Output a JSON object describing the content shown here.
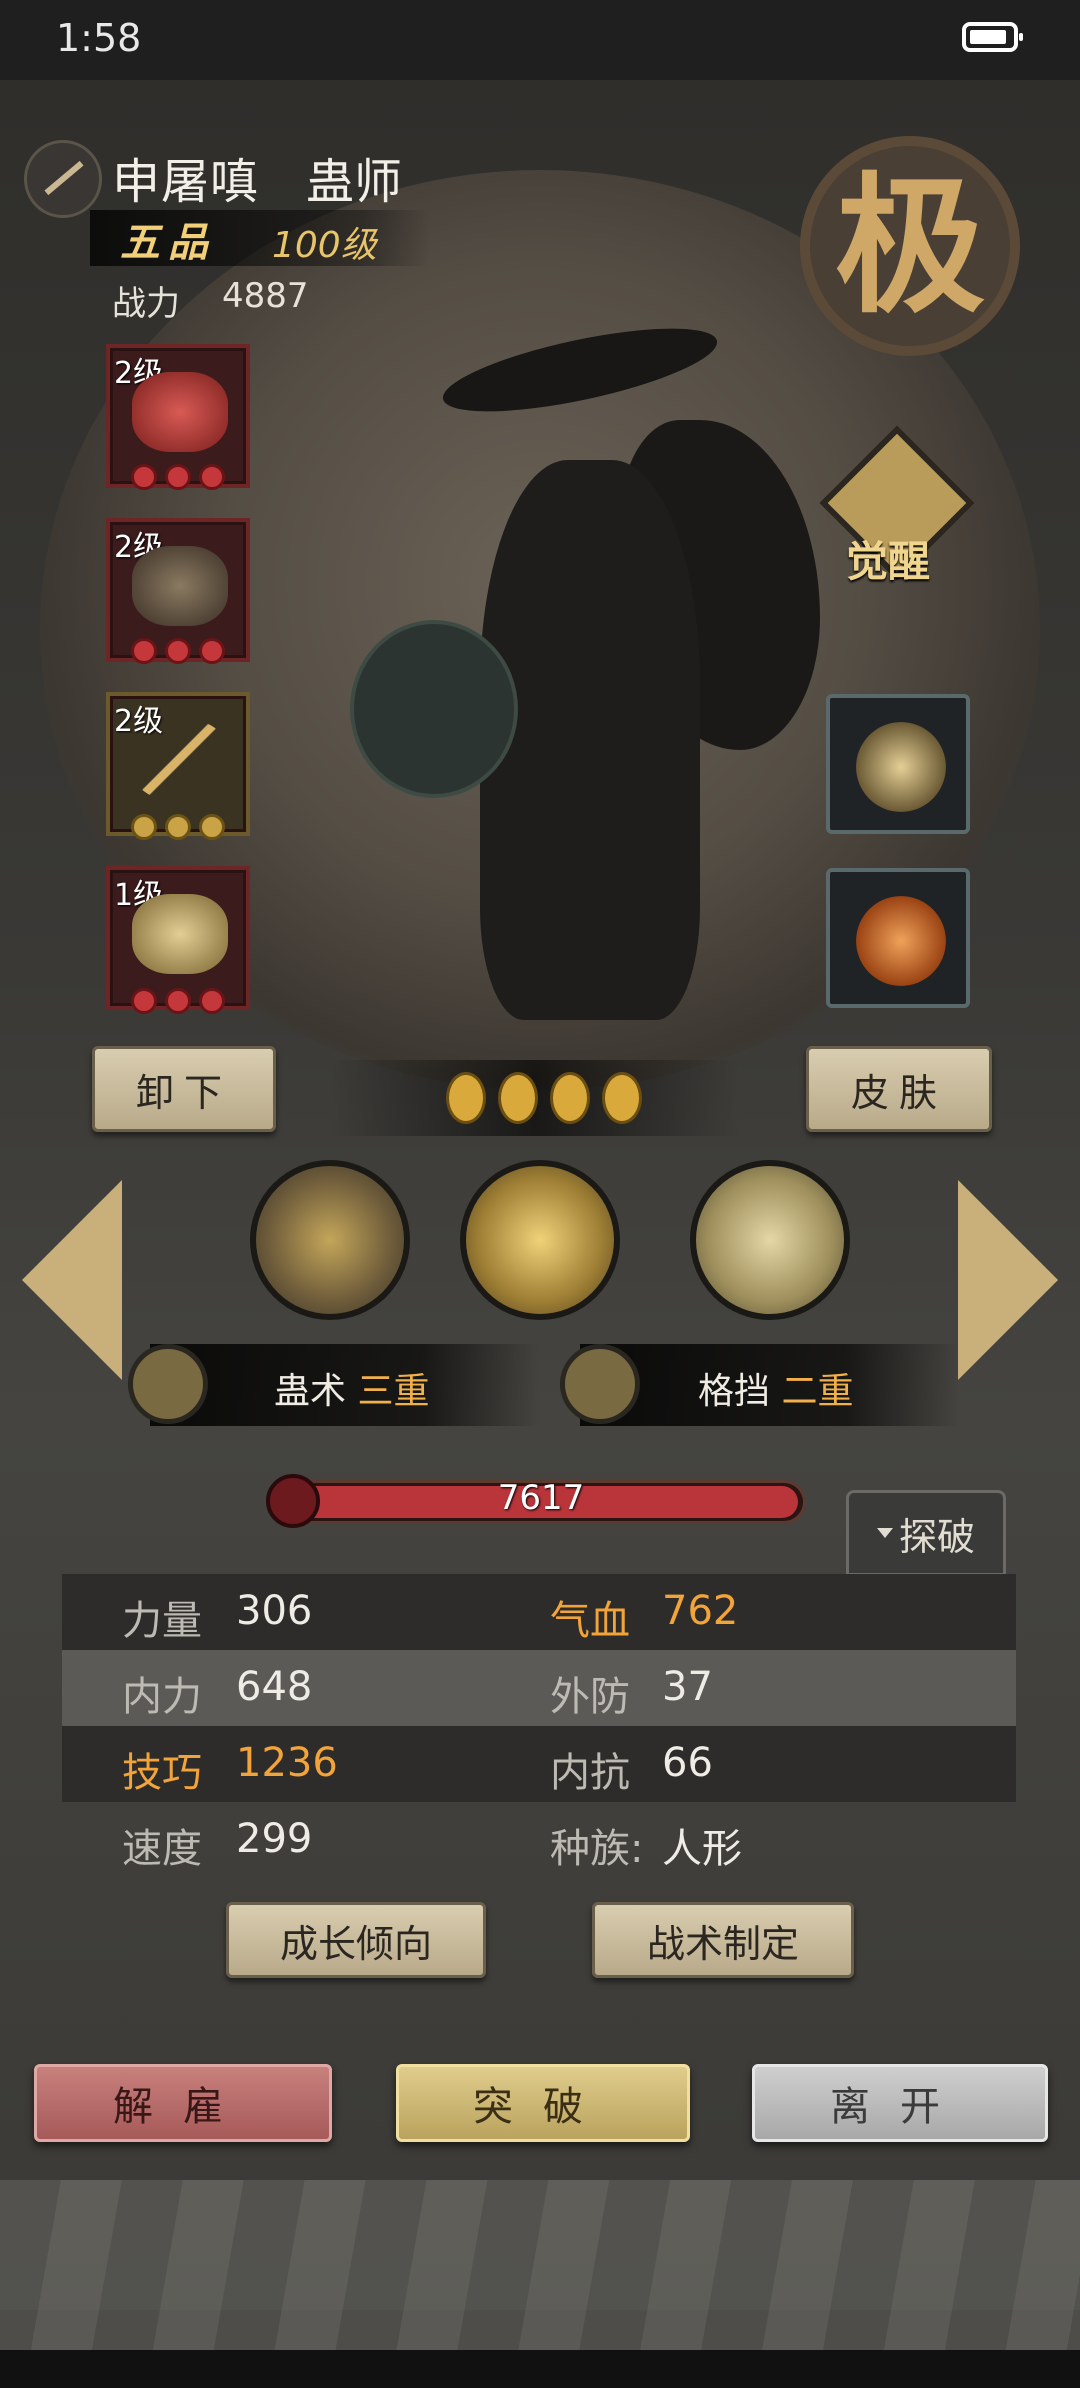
{
  "status": {
    "time": "1:58"
  },
  "hero": {
    "name": "申屠嗔",
    "class": "蛊师",
    "rank": "五品",
    "level": "100级",
    "power_label": "战力",
    "power_value": "4887",
    "grade_seal": "极",
    "awaken_label": "觉醒"
  },
  "equipment": [
    {
      "level": "2级",
      "art": "red-gourd",
      "gem_color": "red"
    },
    {
      "level": "2级",
      "art": "robe",
      "gem_color": "red"
    },
    {
      "level": "2级",
      "art": "golden-whisk",
      "gem_color": "gold"
    },
    {
      "level": "1级",
      "art": "golden-bead",
      "gem_color": "red"
    }
  ],
  "accessories": [
    {
      "art": "golden-flower-pin"
    },
    {
      "art": "amber-stone"
    }
  ],
  "buttons": {
    "unequip": "卸下",
    "skin": "皮肤",
    "explore": "探破",
    "growth": "成长倾向",
    "tactics": "战术制定",
    "dismiss": "解雇",
    "breakthrough": "突破",
    "leave": "离开"
  },
  "star_count": 4,
  "skills": [
    {
      "icon": "serpent-skill-icon"
    },
    {
      "icon": "butterfly-heal-skill-icon"
    },
    {
      "icon": "palm-skill-icon"
    }
  ],
  "passives": [
    {
      "name": "蛊术",
      "tier": "三重"
    },
    {
      "name": "格挡",
      "tier": "二重"
    }
  ],
  "hp": {
    "value": "7617",
    "fill_fraction": 1.0
  },
  "stats": [
    {
      "l_label": "力量",
      "l_value": "306",
      "l_hl": false,
      "r_label": "气血",
      "r_value": "762",
      "r_hl": true
    },
    {
      "l_label": "内力",
      "l_value": "648",
      "l_hl": false,
      "r_label": "外防",
      "r_value": "37",
      "r_hl": false
    },
    {
      "l_label": "技巧",
      "l_value": "1236",
      "l_hl": true,
      "r_label": "内抗",
      "r_value": "66",
      "r_hl": false
    },
    {
      "l_label": "速度",
      "l_value": "299",
      "l_hl": false,
      "r_label": "种族:",
      "r_value": "人形",
      "r_hl": false
    }
  ],
  "colors": {
    "highlight": "#f2a43a",
    "gem_red": "#c4373a",
    "gem_gold": "#c9a345"
  }
}
